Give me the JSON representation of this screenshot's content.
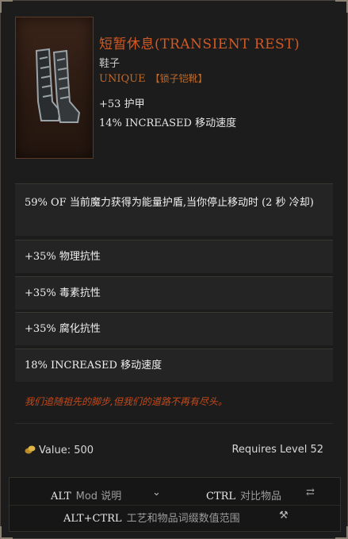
{
  "item": {
    "name": "短暂休息(TRANSIENT REST)",
    "type": "鞋子",
    "rarity": "UNIQUE",
    "base": "【锁子铠靴】",
    "implicits": [
      "+53 护甲",
      "14% INCREASED 移动速度"
    ]
  },
  "affixes": [
    "59% OF 当前魔力获得为能量护盾,当你停止移动时 (2 秒 冷却)",
    "+35% 物理抗性",
    "+35% 毒素抗性",
    "+35% 腐化抗性",
    "18% INCREASED 移动速度"
  ],
  "flavor": "我们追随祖先的脚步,但我们的道路不再有尽头。",
  "footer": {
    "value": "Value: 500",
    "requires": "Requires Level 52"
  },
  "keys": {
    "alt_key": "ALT",
    "alt_desc": "Mod 说明",
    "ctrl_key": "CTRL",
    "ctrl_desc": "对比物品",
    "altctrl_key": "ALT+CTRL",
    "altctrl_desc": "工艺和物品词缀数值范围"
  },
  "colors": {
    "unique": "#d25a24",
    "flavor": "#c14a1c",
    "panel": "#1c1c1c"
  }
}
